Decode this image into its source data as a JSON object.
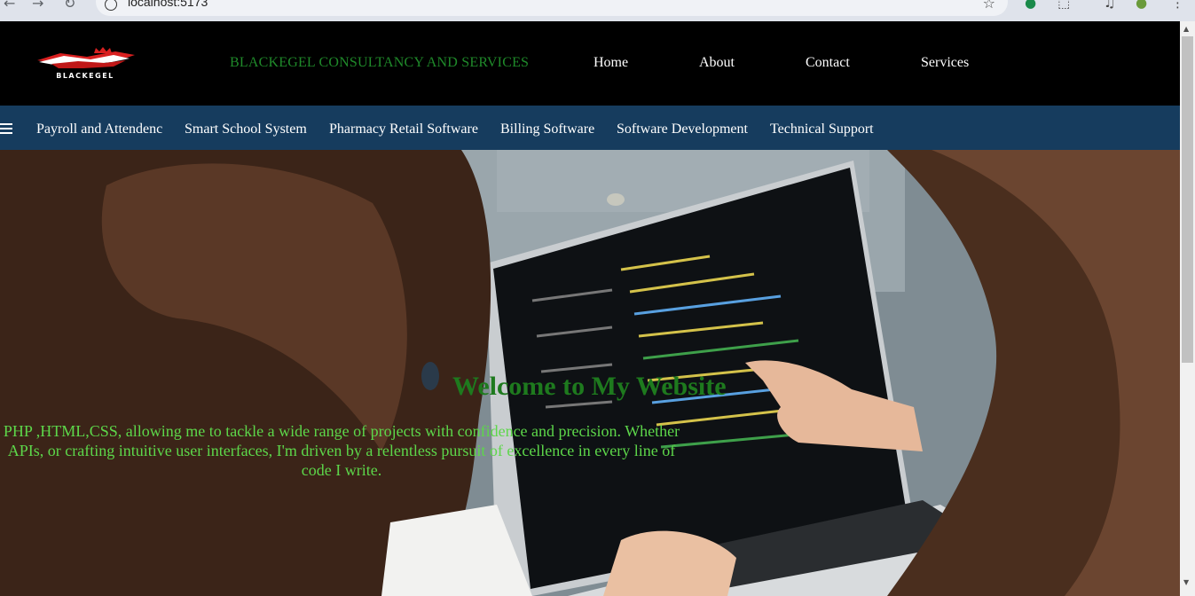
{
  "browser": {
    "url": "localhost:5173"
  },
  "header": {
    "logo_text": "BLACKEGEL",
    "brand": "BLACKEGEL CONSULTANCY AND SERVICES",
    "nav": [
      {
        "label": "Home"
      },
      {
        "label": "About"
      },
      {
        "label": "Contact"
      },
      {
        "label": "Services"
      }
    ]
  },
  "subnav": {
    "items": [
      {
        "label": "Payroll and Attendenc"
      },
      {
        "label": "Smart School System"
      },
      {
        "label": "Pharmacy Retail Software"
      },
      {
        "label": "Billing Software"
      },
      {
        "label": "Software Development"
      },
      {
        "label": "Technical Support"
      }
    ]
  },
  "hero": {
    "title": "Welcome to My Website",
    "lines": [
      "PHP ,HTML,CSS, allowing me to tackle a wide range of projects with confidence and precision. Whether",
      "APIs, or crafting intuitive user interfaces, I'm driven by a relentless pursuit of excellence in every line of",
      "code I write."
    ]
  },
  "colors": {
    "header_bg": "#000000",
    "subnav_bg": "#163c5e",
    "brand_green": "#1f8a2a",
    "title_green": "#1e7a1e",
    "text_green": "#5dd74a"
  }
}
